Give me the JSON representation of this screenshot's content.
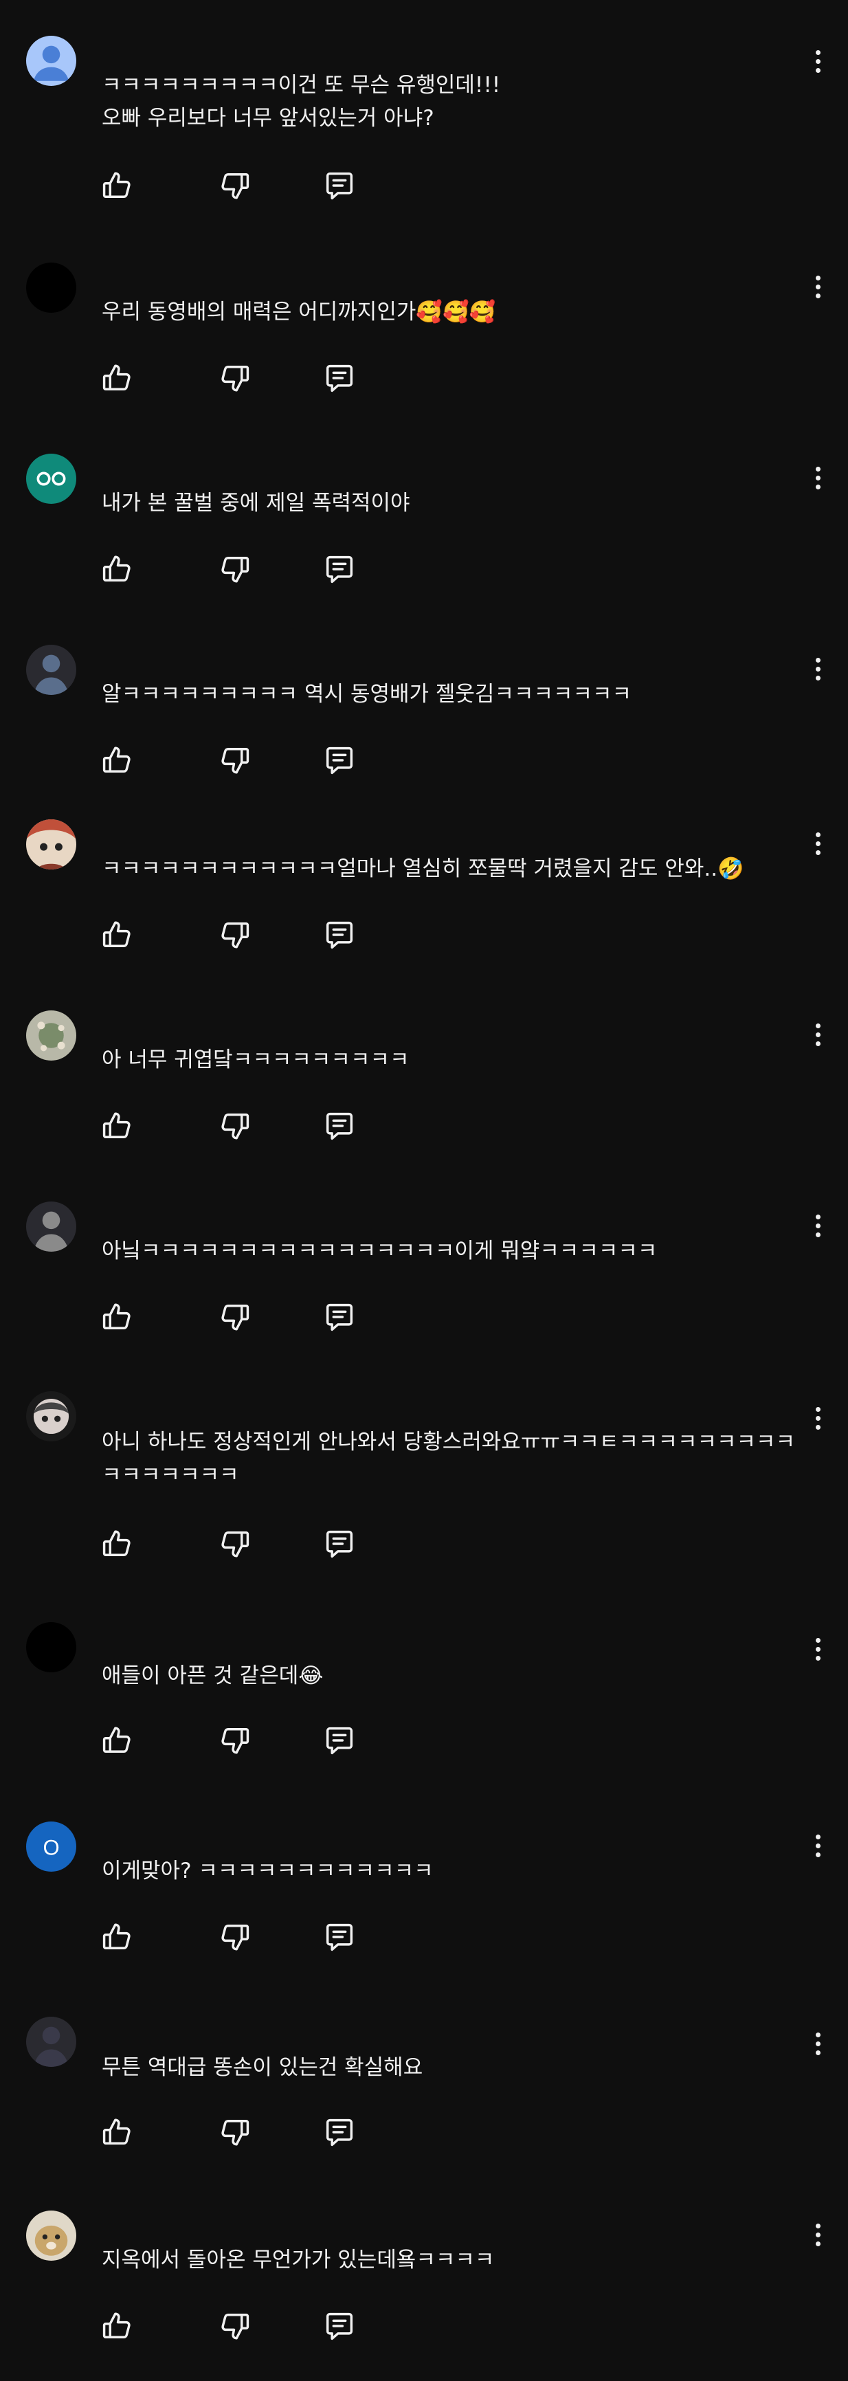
{
  "comments": [
    {
      "text": "ㅋㅋㅋㅋㅋㅋㅋㅋㅋ이건 또 무슨 유행인데!!!\n오빠 우리보다 너무 앞서있는거 아냐?",
      "avatar": "default-person-avatar",
      "avatar_color": "#a8c7fa"
    },
    {
      "text": "우리 동영배의 매력은 어디까지인가🥰🥰🥰",
      "avatar": "black-avatar",
      "avatar_color": "#000000"
    },
    {
      "text": "내가 본 꿀벌 중에 제일 폭력적이야",
      "avatar": "teal-eyes-avatar",
      "avatar_color": "#0f8a7a"
    },
    {
      "text": "알ㅋㅋㅋㅋㅋㅋㅋㅋㅋ 역시 동영배가 젤웃김ㅋㅋㅋㅋㅋㅋㅋ",
      "avatar": "photo-avatar",
      "avatar_color": "#5a6e8c"
    },
    {
      "text": "ㅋㅋㅋㅋㅋㅋㅋㅋㅋㅋㅋㅋ얼마나 열심히 쪼물딱 거렸을지 감도 안와..🤣",
      "avatar": "character-avatar",
      "avatar_color": "#c0503a"
    },
    {
      "text": "아 너무 귀엽닼ㅋㅋㅋㅋㅋㅋㅋㅋㅋ",
      "avatar": "pattern-avatar",
      "avatar_color": "#7a8c6a"
    },
    {
      "text": "아닠ㅋㅋㅋㅋㅋㅋㅋㅋㅋㅋㅋㅋㅋㅋㅋㅋ이게 뭐얔ㅋㅋㅋㅋㅋㅋ",
      "avatar": "photo-avatar",
      "avatar_color": "#8a8a8a"
    },
    {
      "text": "아니 하나도 정상적인게 안나와서 당황스러와요ㅠㅠㅋㅋㅌㅋㅋㅋㅋㅋㅋㅋㅋㅋㅋㅋㅋㅋㅋㅋㅋ",
      "avatar": "cartoon-girl-avatar",
      "avatar_color": "#d9d0cc"
    },
    {
      "text": "애들이 아픈 것 같은데😂",
      "avatar": "black-avatar",
      "avatar_color": "#000000"
    },
    {
      "text": "이게맞아? ㅋㅋㅋㅋㅋㅋㅋㅋㅋㅋㅋㅋ",
      "avatar": "letter-avatar",
      "avatar_letter": "O",
      "avatar_color": "#1565c0"
    },
    {
      "text": "무튼 역대급 똥손이 있는건 확실해요",
      "avatar": "photo-avatar",
      "avatar_color": "#3a3a4a"
    },
    {
      "text": "지옥에서 돌아온 무언가가 있는데욬ㅋㅋㅋㅋ",
      "avatar": "dog-avatar",
      "avatar_color": "#c9a66b"
    }
  ],
  "icons": {
    "like": "thumb-up-icon",
    "dislike": "thumb-down-icon",
    "reply": "reply-icon",
    "more": "more-vert-icon"
  }
}
